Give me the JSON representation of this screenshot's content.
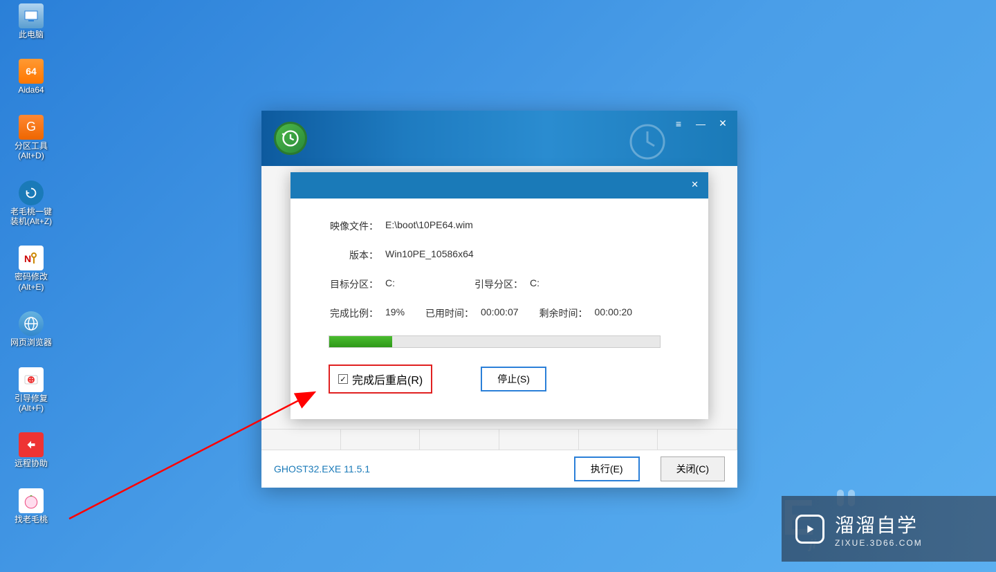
{
  "desktop": {
    "icons": [
      {
        "label": "此电脑",
        "name": "this-pc"
      },
      {
        "label": "Aida64",
        "name": "aida64",
        "badge": "64"
      },
      {
        "label": "分区工具\n(Alt+D)",
        "name": "partition-tool"
      },
      {
        "label": "老毛桃一键\n装机(Alt+Z)",
        "name": "restore-tool"
      },
      {
        "label": "密码修改\n(Alt+E)",
        "name": "password-tool"
      },
      {
        "label": "网页浏览器",
        "name": "browser"
      },
      {
        "label": "引导修复\n(Alt+F)",
        "name": "boot-repair"
      },
      {
        "label": "远程协助",
        "name": "remote-assist"
      },
      {
        "label": "找老毛桃",
        "name": "find-laomaotao"
      }
    ]
  },
  "main_window": {
    "footer_label": "GHOST32.EXE 11.5.1",
    "execute_btn": "执行(E)",
    "close_btn": "关闭(C)"
  },
  "dialog": {
    "image_file_label": "映像文件：",
    "image_file_value": "E:\\boot\\10PE64.wim",
    "version_label": "版本：",
    "version_value": "Win10PE_10586x64",
    "target_label": "目标分区：",
    "target_value": "C:",
    "boot_label": "引导分区：",
    "boot_value": "C:",
    "percent_label": "完成比例：",
    "percent_value": "19%",
    "elapsed_label": "已用时间：",
    "elapsed_value": "00:00:07",
    "remain_label": "剩余时间：",
    "remain_value": "00:00:20",
    "restart_checkbox": "完成后重启(R)",
    "stop_btn": "停止(S)",
    "progress_percent": 19
  },
  "watermark": {
    "title": "溜溜自学",
    "subtitle": "ZIXUE.3D66.COM"
  }
}
